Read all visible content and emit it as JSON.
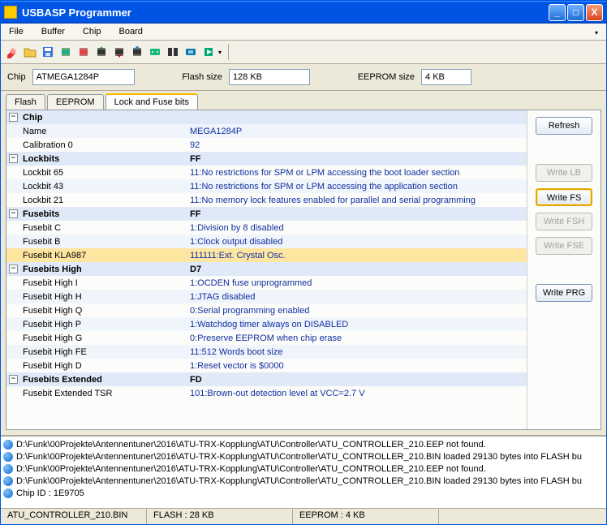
{
  "title": "USBASP Programmer",
  "menu": {
    "file": "File",
    "buffer": "Buffer",
    "chip": "Chip",
    "board": "Board"
  },
  "info": {
    "chip_label": "Chip",
    "chip_value": "ATMEGA1284P",
    "flash_label": "Flash size",
    "flash_value": "128 KB",
    "eeprom_label": "EEPROM size",
    "eeprom_value": "4 KB"
  },
  "tabs": {
    "flash": "Flash",
    "eeprom": "EEPROM",
    "lock": "Lock and Fuse bits"
  },
  "buttons": {
    "refresh": "Refresh",
    "write_lb": "Write LB",
    "write_fs": "Write FS",
    "write_fsh": "Write FSH",
    "write_fse": "Write FSE",
    "write_prg": "Write PRG"
  },
  "grid": [
    {
      "type": "header",
      "name": "Chip",
      "val": ""
    },
    {
      "type": "row",
      "name": "Name",
      "val": "MEGA1284P"
    },
    {
      "type": "row",
      "name": "Calibration 0",
      "val": "92"
    },
    {
      "type": "header",
      "name": "Lockbits",
      "val": "FF"
    },
    {
      "type": "row",
      "name": "Lockbit 65",
      "val": "11:No restrictions for SPM or LPM accessing the boot loader section"
    },
    {
      "type": "row",
      "name": "Lockbit 43",
      "val": "11:No restrictions for SPM or LPM accessing the application section"
    },
    {
      "type": "row",
      "name": "Lockbit 21",
      "val": "11:No memory lock features enabled for parallel and serial programming"
    },
    {
      "type": "header",
      "name": "Fusebits",
      "val": "FF"
    },
    {
      "type": "row",
      "name": "Fusebit C",
      "val": "1:Division by 8 disabled"
    },
    {
      "type": "row",
      "name": "Fusebit B",
      "val": "1:Clock output disabled"
    },
    {
      "type": "row",
      "name": "Fusebit KLA987",
      "val": "111111:Ext. Crystal Osc.",
      "sel": true
    },
    {
      "type": "header",
      "name": "Fusebits High",
      "val": "D7"
    },
    {
      "type": "row",
      "name": "Fusebit High I",
      "val": "1:OCDEN fuse unprogrammed"
    },
    {
      "type": "row",
      "name": "Fusebit High H",
      "val": "1:JTAG disabled"
    },
    {
      "type": "row",
      "name": "Fusebit High Q",
      "val": "0:Serial programming enabled"
    },
    {
      "type": "row",
      "name": "Fusebit High P",
      "val": "1:Watchdog timer always on DISABLED"
    },
    {
      "type": "row",
      "name": "Fusebit High G",
      "val": "0:Preserve EEPROM when chip erase"
    },
    {
      "type": "row",
      "name": "Fusebit High FE",
      "val": "11:512 Words boot size"
    },
    {
      "type": "row",
      "name": "Fusebit High D",
      "val": "1:Reset vector is $0000"
    },
    {
      "type": "header",
      "name": "Fusebits Extended",
      "val": "FD"
    },
    {
      "type": "row",
      "name": "Fusebit Extended TSR",
      "val": "101:Brown-out detection level at VCC=2.7 V"
    }
  ],
  "log": [
    "D:\\Funk\\00Projekte\\Antennentuner\\2016\\ATU-TRX-Kopplung\\ATU\\Controller\\ATU_CONTROLLER_210.EEP not found.",
    "D:\\Funk\\00Projekte\\Antennentuner\\2016\\ATU-TRX-Kopplung\\ATU\\Controller\\ATU_CONTROLLER_210.BIN loaded 29130 bytes into FLASH bu",
    "D:\\Funk\\00Projekte\\Antennentuner\\2016\\ATU-TRX-Kopplung\\ATU\\Controller\\ATU_CONTROLLER_210.EEP not found.",
    "D:\\Funk\\00Projekte\\Antennentuner\\2016\\ATU-TRX-Kopplung\\ATU\\Controller\\ATU_CONTROLLER_210.BIN loaded 29130 bytes into FLASH bu",
    "Chip ID : 1E9705"
  ],
  "status": {
    "file": "ATU_CONTROLLER_210.BIN",
    "flash": "FLASH : 28 KB",
    "eeprom": "EEPROM : 4 KB"
  }
}
